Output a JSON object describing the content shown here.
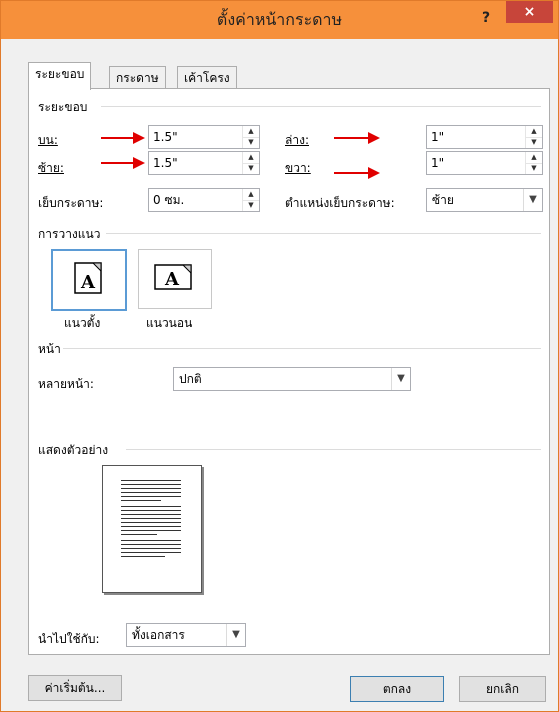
{
  "window": {
    "title": "ตั้งค่าหน้ากระดาษ",
    "help": "?",
    "close": "×"
  },
  "tabs": [
    {
      "label": "ระยะขอบ",
      "active": true
    },
    {
      "label": "กระดาษ",
      "active": false
    },
    {
      "label": "เค้าโครง",
      "active": false
    }
  ],
  "margins": {
    "section": "ระยะขอบ",
    "top_label": "บน:",
    "top_value": "1.5\"",
    "bottom_label": "ล่าง:",
    "bottom_value": "1\"",
    "left_label": "ซ้าย:",
    "left_value": "1.5\"",
    "right_label": "ขวา:",
    "right_value": "1\"",
    "gutter_label": "เย็บกระดาษ:",
    "gutter_value": "0 ซม.",
    "gutter_pos_label": "ตำแหน่งเย็บกระดาษ:",
    "gutter_pos_value": "ซ้าย"
  },
  "orientation": {
    "section": "การวางแนว",
    "portrait": "แนวตั้ง",
    "landscape": "แนวนอน",
    "icon_letter": "A",
    "selected": "portrait"
  },
  "pages": {
    "section": "หน้า",
    "multiple_label": "หลายหน้า:",
    "multiple_value": "ปกติ"
  },
  "preview": {
    "section": "แสดงตัวอย่าง"
  },
  "apply": {
    "label": "นำไปใช้กับ:",
    "value": "ทั้งเอกสาร"
  },
  "buttons": {
    "default": "ค่าเริ่มต้น...",
    "ok": "ตกลง",
    "cancel": "ยกเลิก"
  },
  "colors": {
    "titlebar": "#f6903b",
    "close": "#c7453a",
    "annotation_arrow": "#e00000",
    "selection": "#5b9bd5"
  }
}
